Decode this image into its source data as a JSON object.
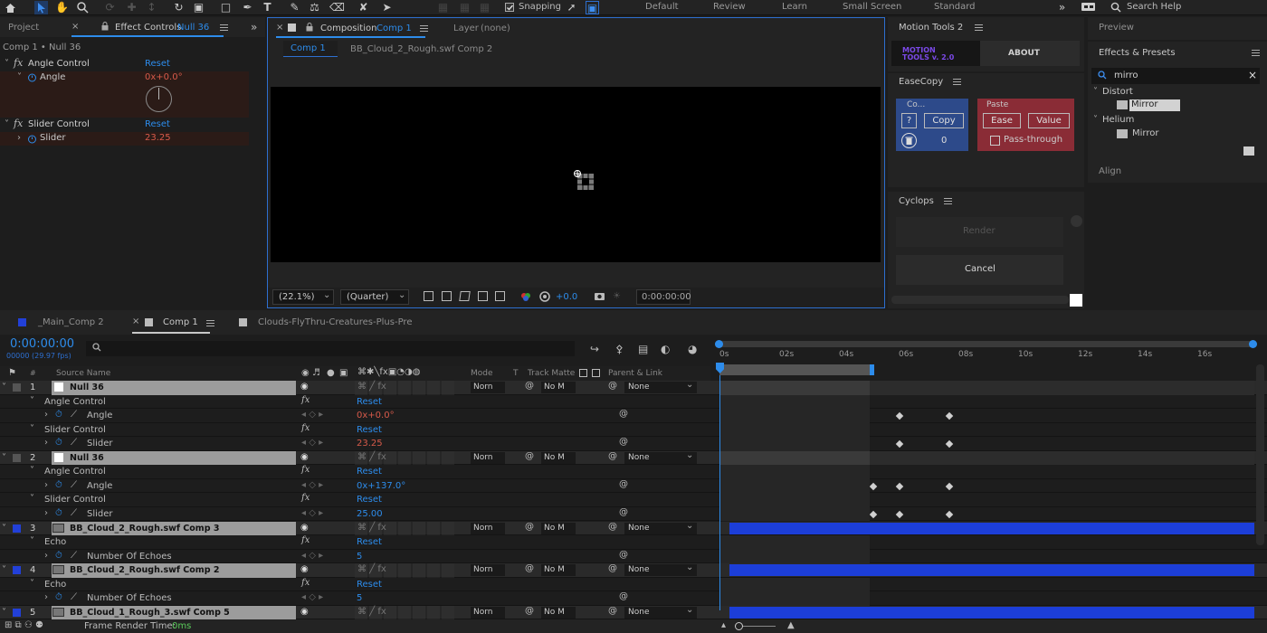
{
  "toolbar": {
    "snapping": "Snapping",
    "workspaces": [
      "Default",
      "Review",
      "Learn",
      "Small Screen",
      "Standard"
    ],
    "search_help": "Search Help"
  },
  "left_panel": {
    "tab_project": "Project",
    "tab_effect_controls": "Effect Controls",
    "tab_effect_target": "Null 36",
    "breadcrumb": "Comp 1 • Null 36",
    "angle_control": "Angle Control",
    "angle_label": "Angle",
    "angle_value": "0x+0.0°",
    "slider_control": "Slider Control",
    "slider_label": "Slider",
    "slider_value": "23.25",
    "reset": "Reset"
  },
  "composition": {
    "tab_label": "Composition",
    "tab_comp": "Comp 1",
    "layer_tab": "Layer",
    "layer_value": "(none)",
    "crumb_comp1": "Comp 1",
    "crumb_comp2": "BB_Cloud_2_Rough.swf Comp 2",
    "zoom": "(22.1%)",
    "resolution": "(Quarter)",
    "exposure": "+0.0",
    "timecode": "0:00:00:00"
  },
  "motion_tools": {
    "title": "Motion Tools 2",
    "logo_line1": "MOTION",
    "logo_line2": "TOOLS v. 2.0",
    "about": "ABOUT"
  },
  "easecopy": {
    "title": "EaseCopy",
    "copy_header": "Co...",
    "question": "?",
    "copy": "Copy",
    "count": "0",
    "paste_header": "Paste",
    "ease": "Ease",
    "value": "Value",
    "pass_through": "Pass-through"
  },
  "cyclops": {
    "title": "Cyclops",
    "render": "Render",
    "cancel": "Cancel"
  },
  "right_panel": {
    "preview": "Preview",
    "effects_presets": "Effects & Presets",
    "search_value": "mirro",
    "group_distort": "Distort",
    "mirror1": "Mirror",
    "group_helium": "Helium",
    "mirror2": "Mirror",
    "align": "Align"
  },
  "timeline": {
    "tabs": [
      "_Main_Comp 2",
      "Comp 1",
      "Clouds-FlyThru-Creatures-Plus-Pre"
    ],
    "timecode": "0:00:00:00",
    "fps": "00000 (29.97 fps)",
    "col_source": "Source Name",
    "col_mode": "Mode",
    "col_t": "T",
    "col_trackmatte": "Track Matte",
    "col_parent": "Parent & Link",
    "ruler": [
      "0s",
      "02s",
      "04s",
      "06s",
      "08s",
      "10s",
      "12s",
      "14s",
      "16s"
    ],
    "mode_value": "Norn",
    "matte_value": "No M",
    "parent_value": "None",
    "reset": "Reset",
    "layers": [
      {
        "num": "1",
        "name": "Null 36",
        "color": "#ffffff"
      },
      {
        "num": "2",
        "name": "Null 36",
        "color": "#ffffff"
      },
      {
        "num": "3",
        "name": "BB_Cloud_2_Rough.swf Comp 3",
        "color": "#2240d8"
      },
      {
        "num": "4",
        "name": "BB_Cloud_2_Rough.swf Comp 2",
        "color": "#2240d8"
      },
      {
        "num": "5",
        "name": "BB_Cloud_1_Rough_3.swf Comp 5",
        "color": "#2240d8"
      }
    ],
    "props": {
      "angle_control": "Angle Control",
      "angle": "Angle",
      "slider_control": "Slider Control",
      "slider": "Slider",
      "echo": "Echo",
      "num_echoes": "Number Of Echoes"
    },
    "values": {
      "l1_angle": "0x+0.0°",
      "l1_slider": "23.25",
      "l2_angle": "0x+137.0°",
      "l2_slider": "25.00",
      "l3_echoes": "5",
      "l4_echoes": "5"
    },
    "frame_render_label": "Frame Render Time:",
    "frame_render_value": "0ms"
  }
}
